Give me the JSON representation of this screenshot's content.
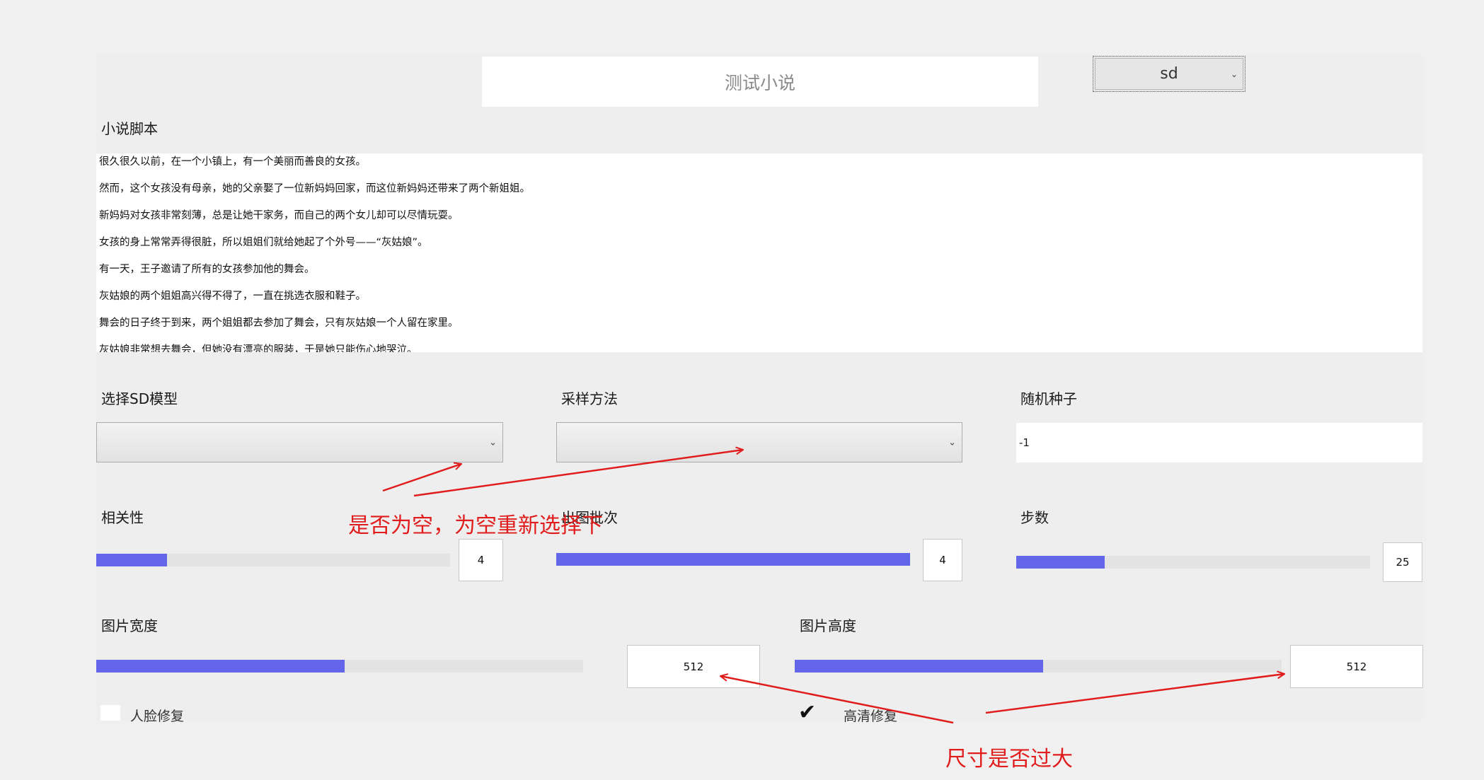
{
  "header": {
    "title": "测试小说",
    "model_select": "sd"
  },
  "script": {
    "label": "小说脚本",
    "lines": [
      "很久很久以前，在一个小镇上，有一个美丽而善良的女孩。",
      "然而，这个女孩没有母亲，她的父亲娶了一位新妈妈回家，而这位新妈妈还带来了两个新姐姐。",
      "新妈妈对女孩非常刻薄，总是让她干家务，而自己的两个女儿却可以尽情玩耍。",
      "女孩的身上常常弄得很脏，所以姐姐们就给她起了个外号——“灰姑娘”。",
      "有一天，王子邀请了所有的女孩参加他的舞会。",
      "灰姑娘的两个姐姐高兴得不得了，一直在挑选衣服和鞋子。",
      "舞会的日子终于到来，两个姐姐都去参加了舞会，只有灰姑娘一个人留在家里。",
      "灰姑娘非常想去舞会，但她没有漂亮的服装，于是她只能伤心地哭泣。"
    ]
  },
  "settings": {
    "sd_model_label": "选择SD模型",
    "sd_model_value": "",
    "sampler_label": "采样方法",
    "sampler_value": "",
    "seed_label": "随机种子",
    "seed_value": "-1",
    "relevance_label": "相关性",
    "relevance_value": "4",
    "relevance_fill": 0.2,
    "batch_label": "出图批次",
    "batch_value": "4",
    "batch_fill": 1.0,
    "steps_label": "步数",
    "steps_value": "25",
    "steps_fill": 0.25,
    "width_label": "图片宽度",
    "width_value": "512",
    "width_fill": 0.51,
    "height_label": "图片高度",
    "height_value": "512",
    "height_fill": 0.51,
    "face_fix_label": "人脸修复",
    "face_fix_checked": false,
    "hires_fix_label": "高清修复",
    "hires_fix_checked": true
  },
  "annotations": {
    "empty_check": "是否为空，为空重新选择下",
    "size_check": "尺寸是否过大",
    "color": "#e01c1c"
  },
  "colors": {
    "slider_fill": "#6466ea",
    "background": "#eeeeee"
  }
}
